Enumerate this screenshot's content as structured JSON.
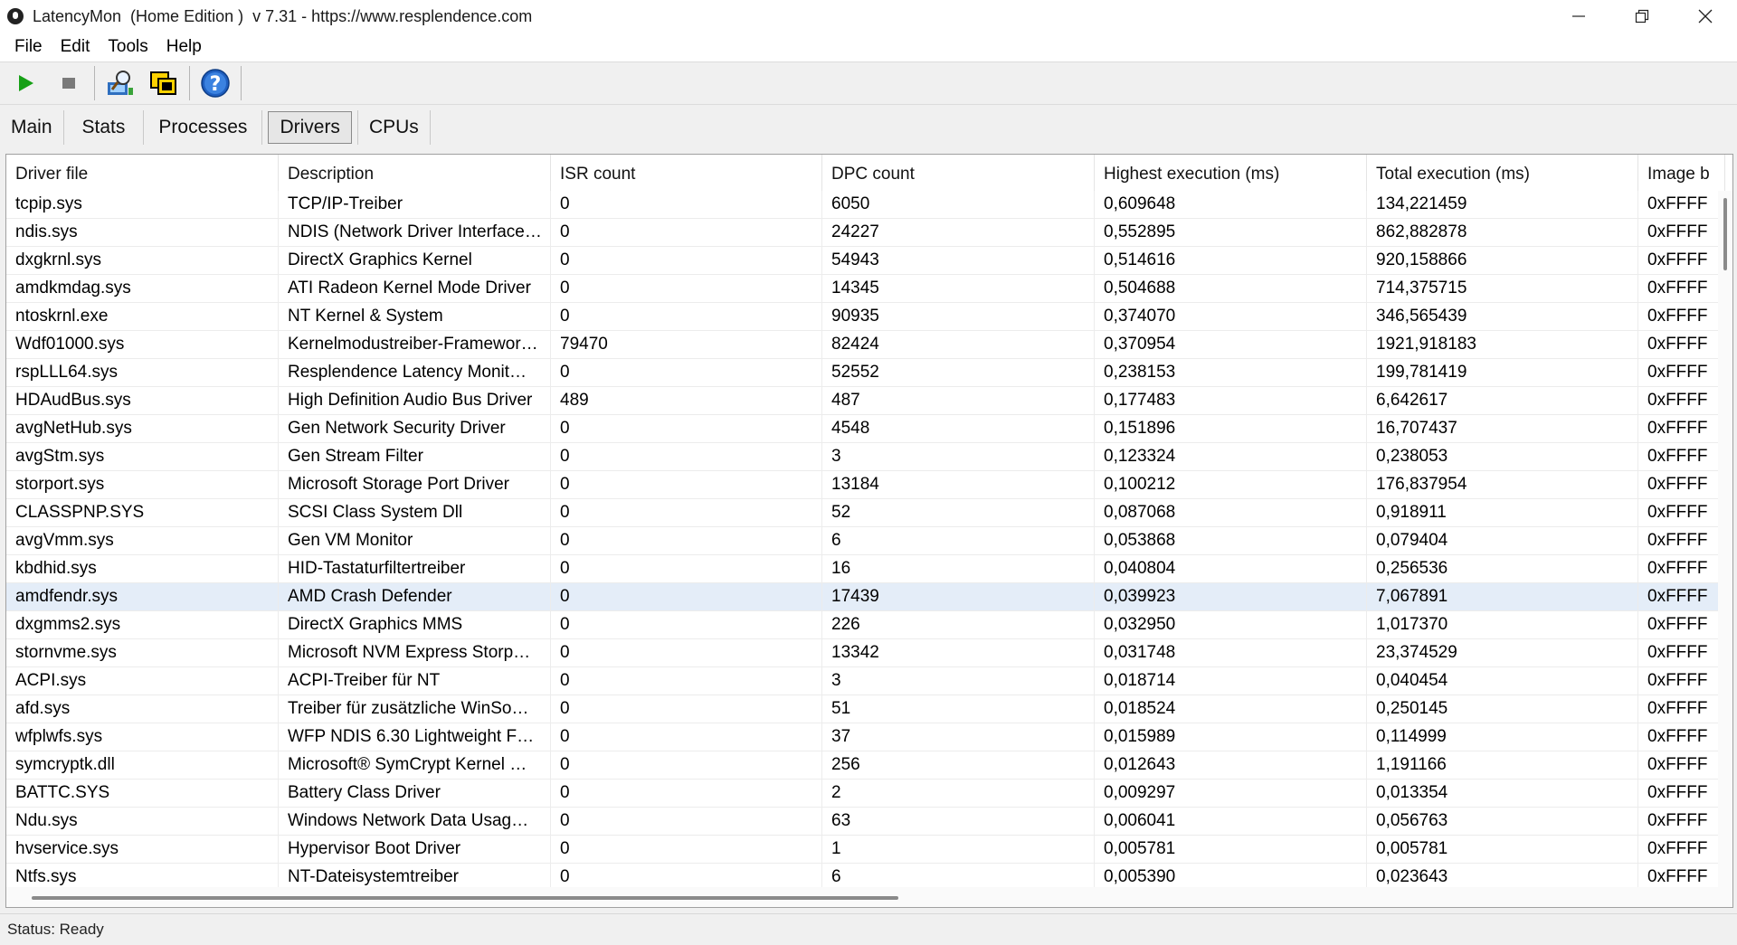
{
  "window": {
    "title": "LatencyMon  (Home Edition )  v 7.31 - https://www.resplendence.com"
  },
  "menu": [
    {
      "label": "File"
    },
    {
      "label": "Edit"
    },
    {
      "label": "Tools"
    },
    {
      "label": "Help"
    }
  ],
  "toolbar": {
    "icons": [
      "play-icon",
      "stop-icon",
      "driver-search-icon",
      "window-cascade-icon",
      "help-icon"
    ],
    "colors": {
      "play": "#16a016",
      "stop": "#7a7a7a",
      "help": "#1f5fc0"
    }
  },
  "tabs": [
    {
      "label": "Main",
      "active": false
    },
    {
      "label": "Stats",
      "active": false
    },
    {
      "label": "Processes",
      "active": false
    },
    {
      "label": "Drivers",
      "active": true
    },
    {
      "label": "CPUs",
      "active": false
    }
  ],
  "table": {
    "columns": [
      "Driver file",
      "Description",
      "ISR count",
      "DPC count",
      "Highest execution (ms)",
      "Total execution (ms)",
      "Image b"
    ],
    "rows": [
      [
        "tcpip.sys",
        "TCP/IP-Treiber",
        "0",
        "6050",
        "0,609648",
        "134,221459",
        "0xFFFF"
      ],
      [
        "ndis.sys",
        "NDIS (Network Driver Interface…",
        "0",
        "24227",
        "0,552895",
        "862,882878",
        "0xFFFF"
      ],
      [
        "dxgkrnl.sys",
        "DirectX Graphics Kernel",
        "0",
        "54943",
        "0,514616",
        "920,158866",
        "0xFFFF"
      ],
      [
        "amdkmdag.sys",
        "ATI Radeon Kernel Mode Driver",
        "0",
        "14345",
        "0,504688",
        "714,375715",
        "0xFFFF"
      ],
      [
        "ntoskrnl.exe",
        "NT Kernel & System",
        "0",
        "90935",
        "0,374070",
        "346,565439",
        "0xFFFF"
      ],
      [
        "Wdf01000.sys",
        "Kernelmodustreiber-Framewor…",
        "79470",
        "82424",
        "0,370954",
        "1921,918183",
        "0xFFFF"
      ],
      [
        "rspLLL64.sys",
        "Resplendence Latency Monit…",
        "0",
        "52552",
        "0,238153",
        "199,781419",
        "0xFFFF"
      ],
      [
        "HDAudBus.sys",
        "High Definition Audio Bus Driver",
        "489",
        "487",
        "0,177483",
        "6,642617",
        "0xFFFF"
      ],
      [
        "avgNetHub.sys",
        "Gen Network Security Driver",
        "0",
        "4548",
        "0,151896",
        "16,707437",
        "0xFFFF"
      ],
      [
        "avgStm.sys",
        "Gen Stream Filter",
        "0",
        "3",
        "0,123324",
        "0,238053",
        "0xFFFF"
      ],
      [
        "storport.sys",
        "Microsoft Storage Port Driver",
        "0",
        "13184",
        "0,100212",
        "176,837954",
        "0xFFFF"
      ],
      [
        "CLASSPNP.SYS",
        "SCSI Class System Dll",
        "0",
        "52",
        "0,087068",
        "0,918911",
        "0xFFFF"
      ],
      [
        "avgVmm.sys",
        "Gen VM Monitor",
        "0",
        "6",
        "0,053868",
        "0,079404",
        "0xFFFF"
      ],
      [
        "kbdhid.sys",
        "HID-Tastaturfiltertreiber",
        "0",
        "16",
        "0,040804",
        "0,256536",
        "0xFFFF"
      ],
      [
        "amdfendr.sys",
        "AMD Crash Defender",
        "0",
        "17439",
        "0,039923",
        "7,067891",
        "0xFFFF"
      ],
      [
        "dxgmms2.sys",
        "DirectX Graphics MMS",
        "0",
        "226",
        "0,032950",
        "1,017370",
        "0xFFFF"
      ],
      [
        "stornvme.sys",
        "Microsoft NVM Express Storp…",
        "0",
        "13342",
        "0,031748",
        "23,374529",
        "0xFFFF"
      ],
      [
        "ACPI.sys",
        "ACPI-Treiber für NT",
        "0",
        "3",
        "0,018714",
        "0,040454",
        "0xFFFF"
      ],
      [
        "afd.sys",
        "Treiber für zusätzliche WinSo…",
        "0",
        "51",
        "0,018524",
        "0,250145",
        "0xFFFF"
      ],
      [
        "wfplwfs.sys",
        "WFP NDIS 6.30 Lightweight F…",
        "0",
        "37",
        "0,015989",
        "0,114999",
        "0xFFFF"
      ],
      [
        "symcryptk.dll",
        "Microsoft® SymCrypt Kernel …",
        "0",
        "256",
        "0,012643",
        "1,191166",
        "0xFFFF"
      ],
      [
        "BATTC.SYS",
        "Battery Class Driver",
        "0",
        "2",
        "0,009297",
        "0,013354",
        "0xFFFF"
      ],
      [
        "Ndu.sys",
        "Windows Network Data Usag…",
        "0",
        "63",
        "0,006041",
        "0,056763",
        "0xFFFF"
      ],
      [
        "hvservice.sys",
        "Hypervisor Boot Driver",
        "0",
        "1",
        "0,005781",
        "0,005781",
        "0xFFFF"
      ],
      [
        "Ntfs.sys",
        "NT-Dateisystemtreiber",
        "0",
        "6",
        "0,005390",
        "0,023643",
        "0xFFFF"
      ]
    ],
    "selected_row": "amdfendr.sys"
  },
  "status": {
    "text": "Status: Ready"
  }
}
